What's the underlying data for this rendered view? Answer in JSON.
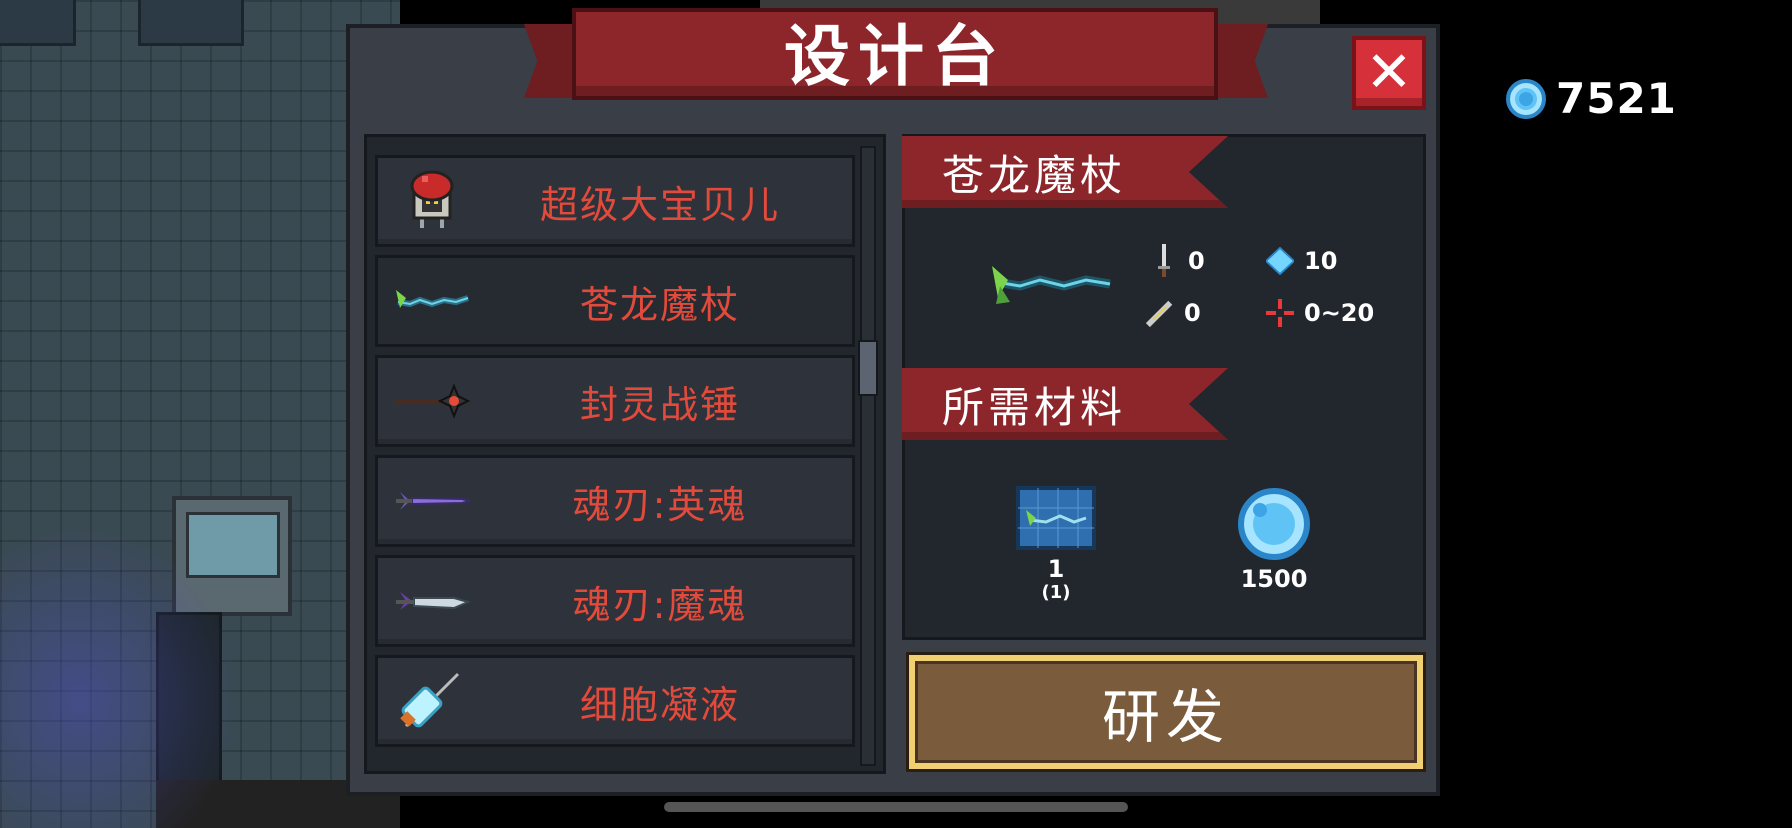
{
  "dialog": {
    "title": "设计台",
    "close_label": "✕"
  },
  "currency": {
    "icon": "gem-coin-icon",
    "amount": "7521"
  },
  "blueprints": [
    {
      "name": "超级大宝贝儿",
      "icon": "baby-bomb-icon"
    },
    {
      "name": "苍龙魔杖",
      "icon": "dragon-staff-icon"
    },
    {
      "name": "封灵战锤",
      "icon": "war-hammer-icon"
    },
    {
      "name": "魂刃:英魂",
      "icon": "purple-sword-icon"
    },
    {
      "name": "魂刃:魔魂",
      "icon": "dark-blade-icon"
    },
    {
      "name": "细胞凝液",
      "icon": "syringe-icon"
    }
  ],
  "selected": {
    "name": "苍龙魔杖",
    "stats": {
      "attack": "0",
      "energy": "10",
      "crit": "0",
      "spread": "0~20"
    }
  },
  "materials": {
    "header": "所需材料",
    "items": [
      {
        "icon": "blueprint-icon",
        "quantity": "1",
        "owned": "(1)"
      },
      {
        "icon": "gem-coin-icon",
        "quantity": "1500"
      }
    ]
  },
  "research_button": "研发",
  "colors": {
    "banner": "#8d262b",
    "item_text": "#e24a3b",
    "close": "#d6313a",
    "gem": "#5fc4f5",
    "button_frame": "#f0d070",
    "button_fill": "#7a5b3c"
  }
}
